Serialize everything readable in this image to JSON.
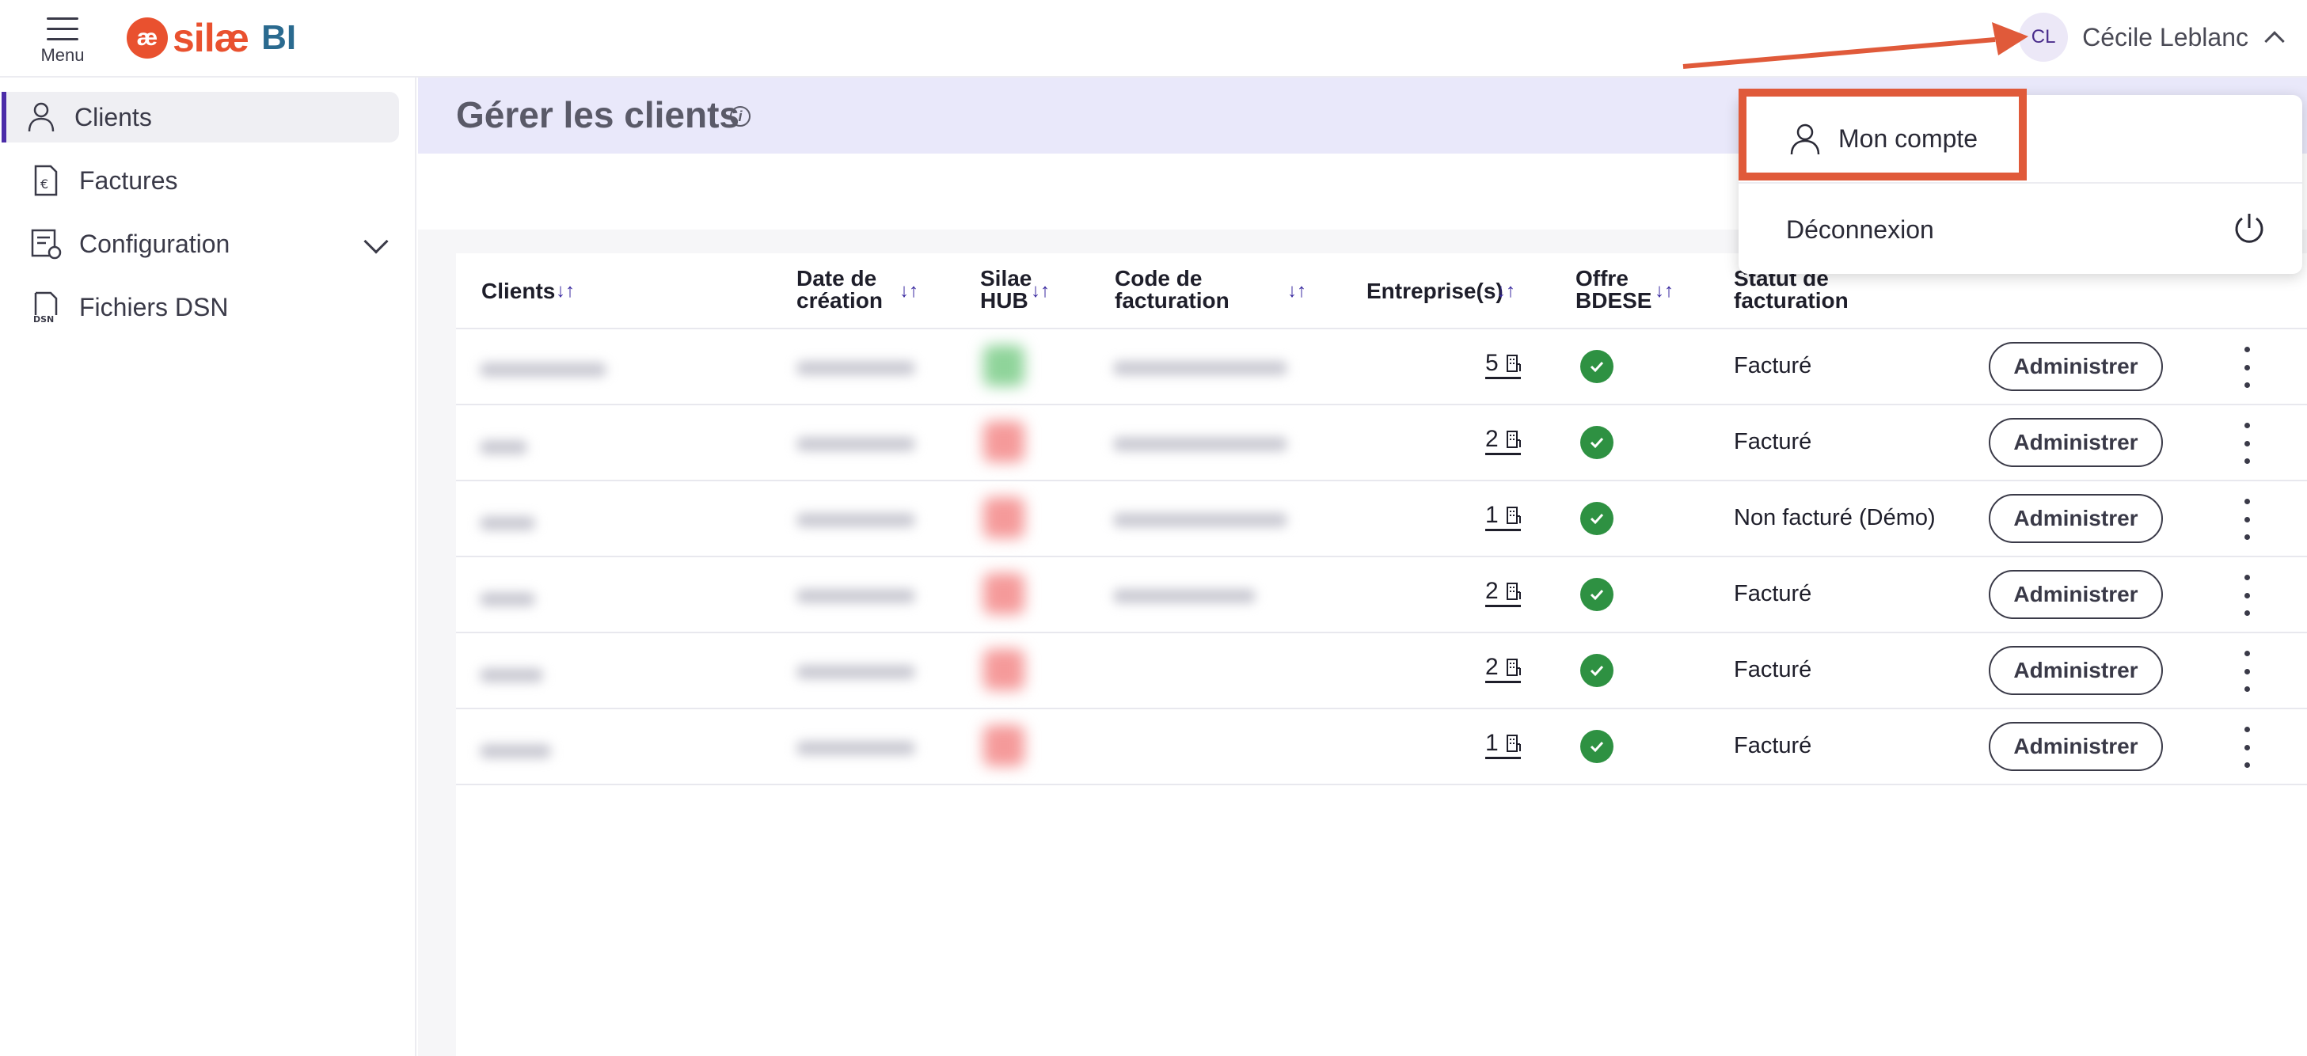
{
  "topbar": {
    "menu_label": "Menu",
    "logo_mark": "æ",
    "logo_text": "silæ",
    "logo_suffix": "BI",
    "user_initials": "CL",
    "user_name": "Cécile Leblanc"
  },
  "sidebar": {
    "items": [
      {
        "label": "Clients",
        "icon": "user-icon",
        "active": true
      },
      {
        "label": "Factures",
        "icon": "invoice-euro-icon"
      },
      {
        "label": "Configuration",
        "icon": "config-icon",
        "expandable": true
      },
      {
        "label": "Fichiers DSN",
        "icon": "dsn-file-icon"
      }
    ]
  },
  "main": {
    "title": "Gérer les clients",
    "info_symbol": "i"
  },
  "table": {
    "columns": {
      "clients": "Clients",
      "date_line1": "Date de",
      "date_line2": "création",
      "hub_line1": "Silae",
      "hub_line2": "HUB",
      "code_line1": "Code de",
      "code_line2": "facturation",
      "entreprises": "Entreprise(s)",
      "offre_line1": "Offre",
      "offre_line2": "BDESE",
      "statut_line1": "Statut de",
      "statut_line2": "facturation"
    },
    "sort_symbol": "↓↑",
    "rows": [
      {
        "entreprises": "5",
        "statut": "Facturé",
        "hub_color": "#8fd49a",
        "action": "Administrer"
      },
      {
        "entreprises": "2",
        "statut": "Facturé",
        "hub_color": "#f59a9a",
        "action": "Administrer"
      },
      {
        "entreprises": "1",
        "statut": "Non facturé (Démo)",
        "hub_color": "#f59a9a",
        "action": "Administrer"
      },
      {
        "entreprises": "2",
        "statut": "Facturé",
        "hub_color": "#f59a9a",
        "action": "Administrer"
      },
      {
        "entreprises": "2",
        "statut": "Facturé",
        "hub_color": "#f59a9a",
        "action": "Administrer"
      },
      {
        "entreprises": "1",
        "statut": "Facturé",
        "hub_color": "#f59a9a",
        "action": "Administrer"
      }
    ]
  },
  "user_menu": {
    "account_label": "Mon compte",
    "logout_label": "Déconnexion"
  },
  "colors": {
    "accent": "#4b2ca8",
    "brand": "#e9512f",
    "annotation": "#e05a3a",
    "success": "#2e9142"
  }
}
